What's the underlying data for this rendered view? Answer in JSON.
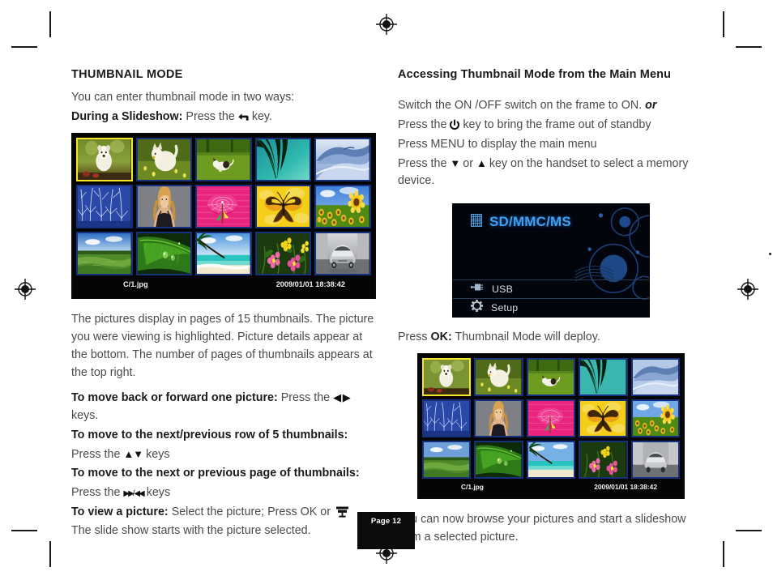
{
  "page": {
    "number_label": "Page 12"
  },
  "left_column": {
    "heading": "THUMBNAIL MODE",
    "intro": "You can enter thumbnail mode in two ways:",
    "slideshow_lead": "During a Slideshow:",
    "slideshow_rest_pre": "Press the",
    "slideshow_rest_post": "key.",
    "return_icon": "return-arrow-icon",
    "paragraph": "The pictures display in pages of 15 thumbnails. The picture you were viewing is highlighted. Picture details appear at the bottom. The number of pages of thumbnails appears at the top right.",
    "instructions": [
      {
        "bold": "To move back or forward one picture:",
        "pre": "Press the",
        "arrows": "◀ ▶",
        "post": "keys."
      },
      {
        "bold": "To move to the next/previous row of 5 thumbnails:",
        "pre": "",
        "arrows": "",
        "post": ""
      },
      {
        "bold": "",
        "pre": "Press the",
        "arrows": "▲▼",
        "post": "keys"
      },
      {
        "bold": "To move to the next or previous page of thumbnails:",
        "pre": "",
        "arrows": "",
        "post": ""
      },
      {
        "bold": "",
        "pre": "Press the",
        "arrows": "▶▶/ ◀◀",
        "post": "keys"
      }
    ],
    "view_picture_bold": "To view a picture:",
    "view_picture_rest": "Select the picture; Press OK or",
    "view_picture_icon": "slideshow-monitor-icon",
    "closing": "The slide show starts with the picture selected."
  },
  "right_column": {
    "heading": "Accessing Thumbnail Mode from the Main Menu",
    "steps": [
      {
        "text": "Switch the ON /OFF switch on the frame to ON.",
        "emphasis": "or"
      },
      {
        "pre": "Press  the",
        "icon": "power-icon",
        "post": "key to bring the frame out of standby"
      },
      {
        "text": "Press MENU to display the main menu"
      },
      {
        "pre": "Press the",
        "arrow1": "▼",
        "mid": "or",
        "arrow2": "▲",
        "post": "key on the handset to select a memory device."
      }
    ],
    "press_ok_bold": "OK:",
    "press_ok_pre": "Press",
    "press_ok_post": "Thumbnail Mode will deploy.",
    "closing": "You can now browse your pictures and start a slideshow from a selected picture."
  },
  "main_menu_screen": {
    "title": "SD/MMC/MS",
    "title_icon": "memory-card-icon",
    "title_color": "#3f9ff0",
    "rows": [
      {
        "label": "USB",
        "icon": "usb-icon"
      },
      {
        "label": "Setup",
        "icon": "gear-icon"
      }
    ]
  },
  "thumbnail_screen": {
    "status_filename": "C/1.jpg",
    "status_datetime": "2009/01/01 18:38:42",
    "selected_index": 0,
    "selection_border_color": "#f5e62a",
    "cell_border_color": "#16307e",
    "thumbnails": [
      {
        "name": "polar-bear-cub",
        "id": "t1"
      },
      {
        "name": "white-dog-running",
        "id": "t2"
      },
      {
        "name": "jack-russell-on-grass",
        "id": "t3"
      },
      {
        "name": "palm-frond-teal",
        "id": "t4"
      },
      {
        "name": "blue-mountain-ridge",
        "id": "t5"
      },
      {
        "name": "frosted-trees",
        "id": "t6"
      },
      {
        "name": "portrait-woman",
        "id": "t7"
      },
      {
        "name": "pink-parasol",
        "id": "t8"
      },
      {
        "name": "yellow-butterfly",
        "id": "t9"
      },
      {
        "name": "sunflower-field",
        "id": "t10"
      },
      {
        "name": "lake-landscape",
        "id": "t11"
      },
      {
        "name": "green-leaf-dew",
        "id": "t12"
      },
      {
        "name": "tropical-beach-palm",
        "id": "t13"
      },
      {
        "name": "pink-flowers",
        "id": "t14"
      },
      {
        "name": "silver-sports-car",
        "id": "t15"
      }
    ]
  }
}
